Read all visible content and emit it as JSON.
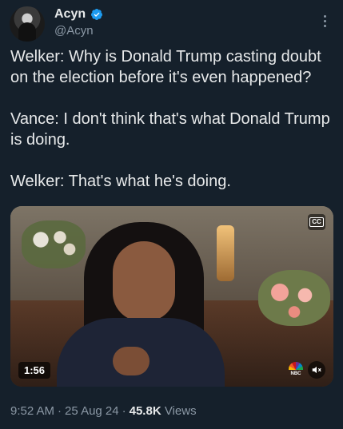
{
  "author": {
    "name": "Acyn",
    "handle": "@Acyn"
  },
  "tweet": {
    "text": "Welker: Why is Donald Trump casting doubt on the election before it's even happened?\n\nVance: I don't think that's what Donald Trump is doing.\n\nWelker: That's what he's doing."
  },
  "media": {
    "duration": "1:56",
    "cc_label": "CC",
    "network_label": "NBC"
  },
  "meta": {
    "time": "9:52 AM",
    "separator": "·",
    "date": "25 Aug 24",
    "views_count": "45.8K",
    "views_label": "Views"
  },
  "colors": {
    "background": "#15202b",
    "verified": "#1d9bf0",
    "secondary_text": "#8b98a5",
    "primary_text": "#e7e9ea"
  },
  "icons": [
    "verified-badge-icon",
    "more-options-icon",
    "closed-captions-icon",
    "nbc-peacock-icon",
    "mute-icon"
  ]
}
